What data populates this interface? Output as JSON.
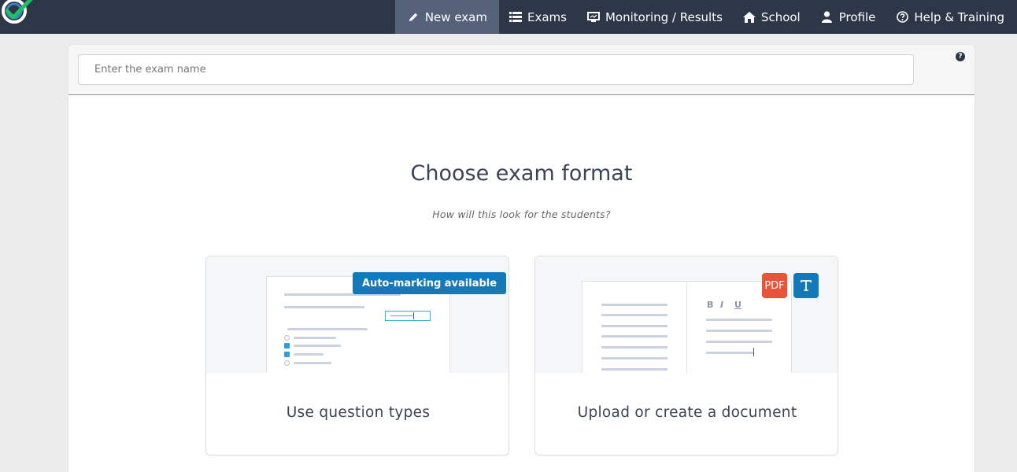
{
  "nav": {
    "items": [
      {
        "label": "New exam",
        "icon": "pencil-icon",
        "active": true
      },
      {
        "label": "Exams",
        "icon": "list-icon",
        "active": false
      },
      {
        "label": "Monitoring / Results",
        "icon": "monitor-icon",
        "active": false
      },
      {
        "label": "School",
        "icon": "home-icon",
        "active": false
      },
      {
        "label": "Profile",
        "icon": "user-icon",
        "active": false
      },
      {
        "label": "Help & Training",
        "icon": "question-circle-icon",
        "active": false
      }
    ]
  },
  "exam": {
    "name_value": "",
    "name_placeholder": "Enter the exam name",
    "help_icon": "question-circle-icon"
  },
  "main": {
    "title": "Choose exam format",
    "subtitle": "How will this look for the students?"
  },
  "options": [
    {
      "label": "Use question types",
      "badge": "Auto-marking available"
    },
    {
      "label": "Upload or create a document",
      "badges": [
        "PDF",
        "T"
      ],
      "format_buttons": [
        "B",
        "I",
        "U"
      ]
    }
  ],
  "colors": {
    "topbar": "#2d3748",
    "active_nav": "#56627a",
    "accent_blue": "#1479b8",
    "pdf_red": "#e8533a",
    "logo_green": "#1fbf6a"
  }
}
